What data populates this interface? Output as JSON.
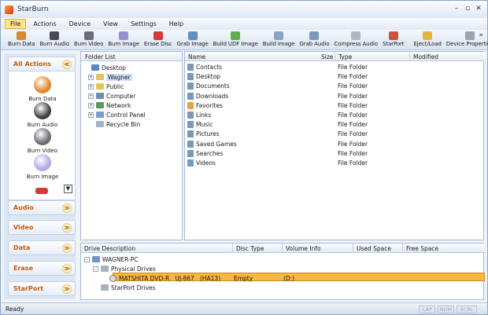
{
  "app": {
    "title": "StarBurn"
  },
  "window_controls": {
    "minimize": "–",
    "restore": "▫",
    "close": "✕"
  },
  "menu": [
    "File",
    "Actions",
    "Device",
    "View",
    "Settings",
    "Help"
  ],
  "toolbar": {
    "items": [
      {
        "label": "Burn Data",
        "color": "#d98a2e"
      },
      {
        "label": "Burn Audio",
        "color": "#4a4a55"
      },
      {
        "label": "Burn Video",
        "color": "#6d6d78"
      },
      {
        "label": "Burn Image",
        "color": "#9a8fd1"
      },
      {
        "label": "Erase Disc",
        "color": "#d33b3b"
      },
      {
        "label": "Grab Image",
        "color": "#5f8fc6"
      },
      {
        "label": "Build UDF Image",
        "color": "#5fae4f"
      },
      {
        "label": "Build Image",
        "color": "#8aa4c8"
      },
      {
        "label": "Grab Audio",
        "color": "#7c9ac0"
      },
      {
        "label": "Compress Audio",
        "color": "#b0b7c4"
      },
      {
        "label": "StarPort",
        "color": "#c9563c"
      },
      {
        "label": "Eject/Load",
        "color": "#e8b33d"
      },
      {
        "label": "Device Properties",
        "color": "#9ca3ad"
      }
    ],
    "more": "»"
  },
  "sidebar": {
    "all_actions": "All Actions",
    "actions": [
      {
        "label": "Burn Data",
        "color": "#e2862f"
      },
      {
        "label": "Burn Audio",
        "color": "#3f3f46"
      },
      {
        "label": "Burn Video",
        "color": "#6b6b73"
      },
      {
        "label": "Burn Image",
        "color": "#b5a8e8"
      }
    ],
    "sections": [
      "Audio",
      "Video",
      "Data",
      "Erase",
      "StarPort"
    ],
    "collapse_glyph": "≪",
    "expand_glyph": "≫"
  },
  "folder_list": {
    "header": "Folder List",
    "items": [
      {
        "label": "Desktop",
        "indent": 0,
        "expander": "",
        "color": "#5b86c4",
        "selected": false
      },
      {
        "label": "Wagner",
        "indent": 1,
        "expander": "+",
        "color": "#e7c45a",
        "selected": true
      },
      {
        "label": "Public",
        "indent": 1,
        "expander": "+",
        "color": "#e7c45a",
        "selected": false
      },
      {
        "label": "Computer",
        "indent": 1,
        "expander": "+",
        "color": "#6a8fb8",
        "selected": false
      },
      {
        "label": "Network",
        "indent": 1,
        "expander": "+",
        "color": "#5a9a5e",
        "selected": false
      },
      {
        "label": "Control Panel",
        "indent": 1,
        "expander": "+",
        "color": "#7a9bd0",
        "selected": false
      },
      {
        "label": "Recycle Bin",
        "indent": 1,
        "expander": "",
        "color": "#9fb3cc",
        "selected": false
      }
    ]
  },
  "file_list": {
    "columns": [
      "Name",
      "Size",
      "Type",
      "Modified"
    ],
    "rows": [
      {
        "name": "Contacts",
        "type": "File Folder",
        "color": "#7a97bc"
      },
      {
        "name": "Desktop",
        "type": "File Folder",
        "color": "#7a97bc"
      },
      {
        "name": "Documents",
        "type": "File Folder",
        "color": "#7a97bc"
      },
      {
        "name": "Downloads",
        "type": "File Folder",
        "color": "#7a97bc"
      },
      {
        "name": "Favorites",
        "type": "File Folder",
        "color": "#e2a43a"
      },
      {
        "name": "Links",
        "type": "File Folder",
        "color": "#7a97bc"
      },
      {
        "name": "Music",
        "type": "File Folder",
        "color": "#7a97bc"
      },
      {
        "name": "Pictures",
        "type": "File Folder",
        "color": "#7a97bc"
      },
      {
        "name": "Saved Games",
        "type": "File Folder",
        "color": "#7a97bc"
      },
      {
        "name": "Searches",
        "type": "File Folder",
        "color": "#7a97bc"
      },
      {
        "name": "Videos",
        "type": "File Folder",
        "color": "#7a97bc"
      }
    ]
  },
  "drives": {
    "columns": [
      "Drive Description",
      "Disc Type",
      "Volume Info",
      "Used Space",
      "Free Space"
    ],
    "tree": [
      {
        "label": "WAGNER-PC",
        "level": 0,
        "expander": "–"
      },
      {
        "label": "Physical Drives",
        "level": 1,
        "expander": "–"
      },
      {
        "label": "MATSHITA DVD-R   UJ-867   (HA13)",
        "level": 2,
        "expander": "",
        "disc_type": "Empty",
        "volume": "(D:)",
        "selected": true
      },
      {
        "label": "StarPort Drives",
        "level": 1,
        "expander": ""
      }
    ]
  },
  "status": {
    "text": "Ready",
    "indicators": [
      "CAP",
      "NUM",
      "SCRL"
    ]
  }
}
